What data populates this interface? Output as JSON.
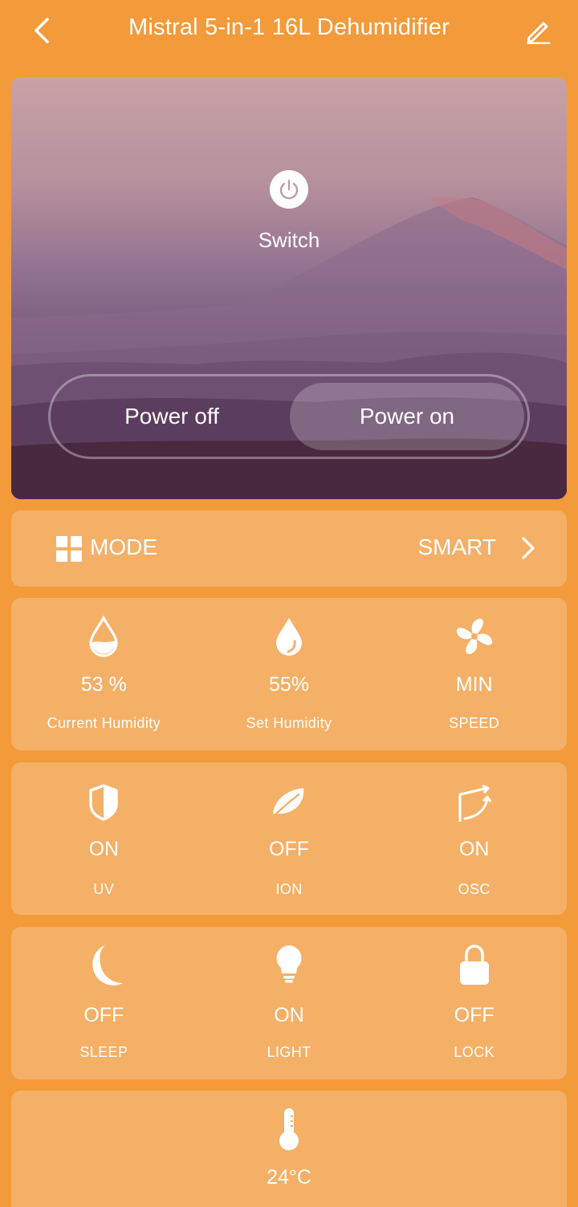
{
  "header": {
    "title": "Mistral 5-in-1 16L Dehumidifier"
  },
  "hero": {
    "switch_label": "Switch",
    "power_off_label": "Power off",
    "power_on_label": "Power on",
    "selected": "Power on"
  },
  "mode": {
    "label": "MODE",
    "value": "SMART"
  },
  "row1": [
    {
      "icon": "water-drop-half-icon",
      "value": "53 %",
      "label": "Current Humidity"
    },
    {
      "icon": "water-drop-icon",
      "value": "55%",
      "label": "Set Humidity"
    },
    {
      "icon": "fan-icon",
      "value": "MIN",
      "label": "SPEED"
    }
  ],
  "row2": [
    {
      "icon": "shield-icon",
      "value": "ON",
      "label": "UV"
    },
    {
      "icon": "leaf-icon",
      "value": "OFF",
      "label": "ION"
    },
    {
      "icon": "oscillation-icon",
      "value": "ON",
      "label": "OSC"
    }
  ],
  "row3": [
    {
      "icon": "moon-icon",
      "value": "OFF",
      "label": "SLEEP"
    },
    {
      "icon": "lightbulb-icon",
      "value": "ON",
      "label": "LIGHT"
    },
    {
      "icon": "lock-icon",
      "value": "OFF",
      "label": "LOCK"
    }
  ],
  "temperature": {
    "icon": "thermometer-icon",
    "value": "24°C"
  },
  "colors": {
    "background": "#F39A3A",
    "card": "#F5B067",
    "text": "#FFFFFF"
  }
}
